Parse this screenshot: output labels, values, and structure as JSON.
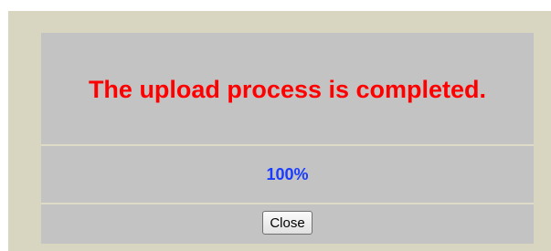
{
  "dialog": {
    "message": "The upload process is completed.",
    "progress_text": "100%",
    "progress": 1.0,
    "close_label": "Close"
  },
  "colors": {
    "background": "#d8d5c0",
    "panel": "#c3c3c3",
    "message": "#ff0000",
    "progress_text": "#1a3cff"
  }
}
